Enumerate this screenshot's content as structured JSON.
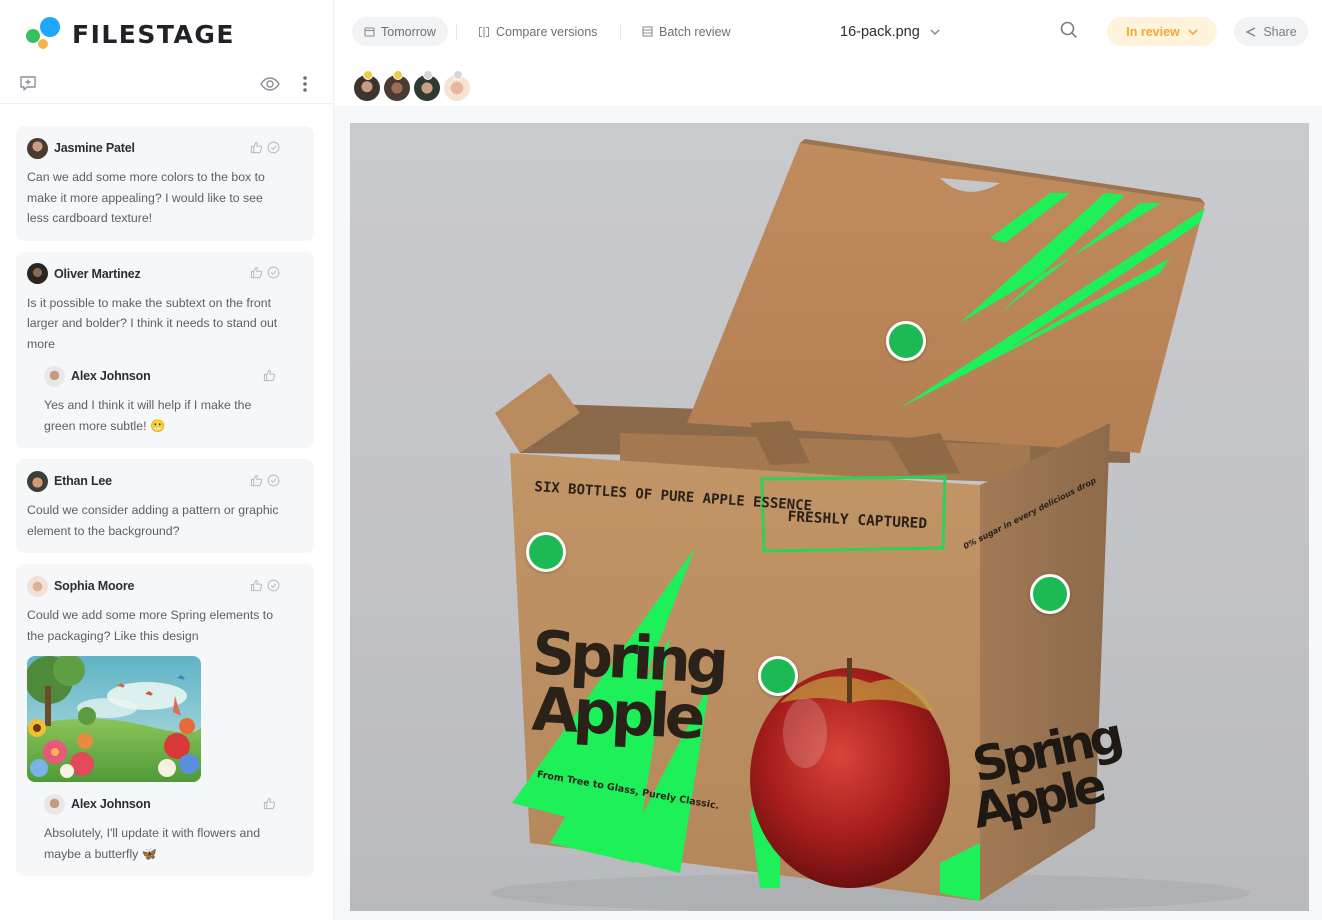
{
  "brand": {
    "name": "FILESTAGE",
    "colors": {
      "green": "#35c15f",
      "blue": "#1ea7ff",
      "orange": "#f7b24a"
    }
  },
  "sidebar": {
    "tools": {
      "add_comment_icon": "comment-plus-icon",
      "visibility_icon": "eye-icon",
      "more_icon": "more-vertical-icon"
    },
    "comments": [
      {
        "author": "Jasmine Patel",
        "text": "Can we add some more colors to the box to make it more appealing? I would like to see less cardboard texture!",
        "actions": [
          "like",
          "resolve"
        ],
        "replies": []
      },
      {
        "author": "Oliver Martinez",
        "text": "Is it possible to make the subtext on the front larger and bolder? I think it needs to stand out more",
        "actions": [
          "like",
          "resolve"
        ],
        "replies": [
          {
            "author": "Alex Johnson",
            "text": "Yes and I think it will help if I make the green more subtle! 😬",
            "actions": [
              "like"
            ]
          }
        ]
      },
      {
        "author": "Ethan Lee",
        "text": "Could we consider adding a pattern or graphic element to the background?",
        "actions": [
          "like",
          "resolve"
        ],
        "replies": []
      },
      {
        "author": "Sophia Moore",
        "text": "Could we add some more Spring elements to the packaging? Like this design",
        "attachment": "spring-meadow-illustration",
        "actions": [
          "like",
          "resolve"
        ],
        "replies": [
          {
            "author": "Alex Johnson",
            "text": "Absolutely, I'll update it with flowers and maybe a butterfly 🦋",
            "actions": [
              "like"
            ]
          }
        ]
      }
    ]
  },
  "topbar": {
    "due_label": "Tomorrow",
    "compare_label": "Compare versions",
    "batch_label": "Batch review",
    "file_name": "16-pack.png",
    "status_label": "In review",
    "status_color": "#f2a93b",
    "share_label": "Share"
  },
  "reviewers": [
    {
      "name": "reviewer-1",
      "status": "pending",
      "dot_color": "#f5c842"
    },
    {
      "name": "reviewer-2",
      "status": "pending",
      "dot_color": "#f5c842"
    },
    {
      "name": "reviewer-3",
      "status": "none",
      "dot_color": "#d5d7db"
    },
    {
      "name": "reviewer-4",
      "status": "none",
      "dot_color": "#d5d7db"
    }
  ],
  "artwork": {
    "headline_top": "SIX BOTTLES OF PURE APPLE ESSENCE",
    "headline_highlight": "FRESHLY CAPTURED",
    "brand_line1": "Spring",
    "brand_line2": "Apple",
    "tagline": "From Tree to Glass, Purely Classic.",
    "side_heading": "0% sugar in every delicious drop",
    "accent_color": "#1ef05a",
    "annotation_color": "#1db954",
    "annotation_count": 4
  }
}
